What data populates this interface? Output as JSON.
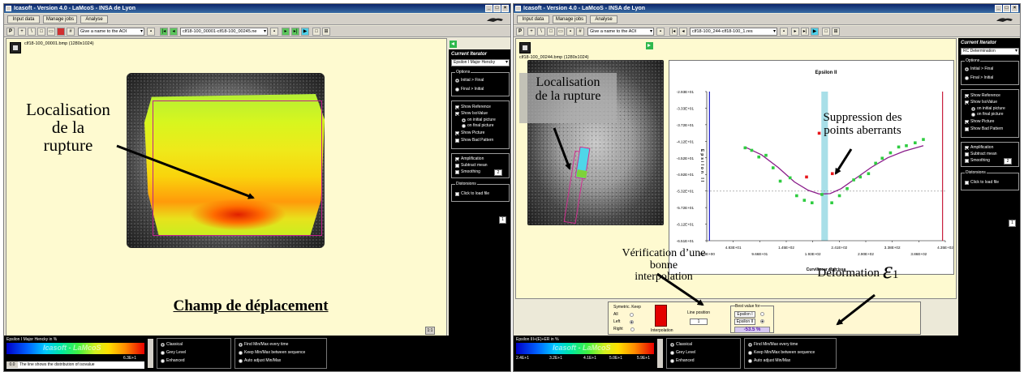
{
  "left_window": {
    "title": "Icasoft - Version 4.0 - LaMcoS - INSA de Lyon",
    "tabs": [
      "Input data",
      "Manage jobs",
      "Analyse"
    ],
    "aoi_combo": "Give a name to the AOI",
    "sequence_combo": "clf18-100_00001-clf18-100_00245.ne",
    "image_info": "clf18-100_00001.bmp (1280x1024)",
    "side_panel": {
      "title": "Current Iterator",
      "combo": "Epsilon I Major Hencky",
      "options_caption": "Options",
      "radio_initial_final": "Initial > Final",
      "radio_final_initial": "Final > Initial",
      "show_reference": "Show Reference",
      "show_isovalue": "Show IsoValue",
      "on_initial_picture": "on initial picture",
      "on_final_picture": "on final picture",
      "show_picture": "Show Picture",
      "show_bad_pattern": "Show Bad Pattern",
      "amplification": "Amplification",
      "subtract_mean": "Subtract mean",
      "smoothing": "Smoothing",
      "smoothing_value": "2",
      "distorsions_caption": "Distorsions",
      "click_to_load": "Click to load file",
      "page_button": "1"
    },
    "scale_button": "1:1",
    "colorbar": {
      "title": "Epsilon I Major Hencky in %",
      "logo": "Icasoft - LaMcoS",
      "tick_min": "0.0E+0",
      "tick_max": "6.3E+1",
      "status_value": "0.0",
      "status_text": "The line shows the distribution of isovalue"
    },
    "display_modes": [
      "Classical",
      "Grey Level",
      "Enhanced"
    ],
    "minmax_modes": [
      "Find Min/Max every time",
      "Keep Min/Max between sequence",
      "Auto adjust Min/Max"
    ]
  },
  "right_window": {
    "title": "Icasoft - Version 4.0 - LaMcoS - INSA de Lyon",
    "tabs": [
      "Input data",
      "Manage jobs",
      "Analyse"
    ],
    "aoi_combo": "Give a name to the AOI",
    "sequence_combo": "clf18-100_244-clf18-100_1.res",
    "image_info": "clf18-100_00244.bmp (1280x1024)",
    "side_panel": {
      "title": "Current Iterator",
      "combo": "RC Determination",
      "options_caption": "Options",
      "radio_initial_final": "Initial > Final",
      "radio_final_initial": "Final > Initial",
      "show_reference": "Show Reference",
      "show_isovalue": "Show IsoValue",
      "on_initial_picture": "on initial picture",
      "on_final_picture": "on final picture",
      "show_picture": "Show Picture",
      "show_bad_pattern": "Show Bad Pattern",
      "amplification": "Amplification",
      "subtract_mean": "Subtract mean",
      "smoothing": "Smoothing",
      "smoothing_value": "2",
      "distorsions_caption": "Distorsions",
      "click_to_load": "Click to load file",
      "page_button": "1"
    },
    "colorbar": {
      "title": "Epsilon III+(E)+ER in %",
      "logo": "Icasoft - LaMcoS",
      "ticks": [
        "2.4E+1",
        "3.2E+1",
        "4.1E+1",
        "5.0E+1",
        "5.9E+1"
      ]
    },
    "display_modes": [
      "Classical",
      "Grey Level",
      "Enhanced"
    ],
    "minmax_modes": [
      "Find Min/Max every time",
      "Keep Min/Max between sequence",
      "Auto adjust Min/Max"
    ],
    "control_panel": {
      "symetric_label": "Symetric. Keep",
      "opt_all": "All",
      "opt_left": "Left",
      "opt_right": "Right",
      "interpolation": "Interpolation",
      "line_position": "Line position",
      "line_position_value": "1",
      "best_value_for": "Best value for",
      "epsilon_1": "Epsilon I",
      "epsilon_2": "Epsilon II",
      "percent_value": "-53.5 %"
    }
  },
  "annotations": {
    "left_rupture": "Localisation\nde la\nrupture",
    "champ": "Champ de déplacement",
    "right_rupture": "Localisation\nde la rupture",
    "suppression": "Suppression des\npoints aberrants",
    "verification": "Vérification d’une\nbonne\ninterpolation",
    "deformation": "Déformation",
    "epsilon_symbol": "ε",
    "epsilon_sub": "1"
  },
  "chart_data": {
    "type": "scatter",
    "title": "Epsilon II",
    "xlabel": "Curvilinear abscissa",
    "ylabel": "Epsilon II",
    "x_ticks": [
      "0.00E+00",
      "4.83E+01",
      "9.66E+01",
      "1.45E+02",
      "1.93E+02",
      "2.41E+02",
      "2.90E+02",
      "3.38E+02",
      "3.86E+02",
      "4.35E+02"
    ],
    "y_ticks": [
      "-2.93E+01",
      "-3.33E+01",
      "-3.72E+01",
      "-4.12E+01",
      "-4.52E+01",
      "-4.92E+01",
      "-5.32E+01",
      "-5.72E+01",
      "-6.12E+01",
      "-6.51E+01"
    ],
    "xlim": [
      0,
      435
    ],
    "ylim": [
      -65.1,
      -29.3
    ],
    "grid": false,
    "legend": "none",
    "reference_line_y": -53.2,
    "rupture_band_x": [
      209,
      221
    ],
    "left_marker_x": 5,
    "right_marker_x": 430,
    "points_valid": [
      [
        70,
        -42.8
      ],
      [
        82,
        -43.4
      ],
      [
        95,
        -45.0
      ],
      [
        108,
        -44.6
      ],
      [
        121,
        -47.6
      ],
      [
        134,
        -50.8
      ],
      [
        152,
        -50.0
      ],
      [
        164,
        -54.3
      ],
      [
        178,
        -55.4
      ],
      [
        192,
        -56.0
      ],
      [
        210,
        -54.0
      ],
      [
        228,
        -56.0
      ],
      [
        242,
        -54.3
      ],
      [
        256,
        -52.6
      ],
      [
        268,
        -50.5
      ],
      [
        280,
        -49.8
      ],
      [
        295,
        -49.0
      ],
      [
        308,
        -46.5
      ],
      [
        320,
        -45.3
      ],
      [
        335,
        -44.0
      ],
      [
        350,
        -42.6
      ],
      [
        364,
        -42.3
      ],
      [
        380,
        -41.6
      ],
      [
        395,
        -40.8
      ]
    ],
    "points_rejected": [
      [
        182,
        -49.8
      ],
      [
        205,
        -39.3
      ],
      [
        229,
        -49.0
      ]
    ],
    "fit_curve": [
      [
        70,
        -42.6
      ],
      [
        100,
        -44.5
      ],
      [
        130,
        -47.5
      ],
      [
        160,
        -51.0
      ],
      [
        185,
        -53.0
      ],
      [
        205,
        -53.9
      ],
      [
        225,
        -53.8
      ],
      [
        245,
        -52.6
      ],
      [
        270,
        -50.3
      ],
      [
        300,
        -47.5
      ],
      [
        330,
        -45.2
      ],
      [
        360,
        -43.6
      ],
      [
        395,
        -42.3
      ]
    ]
  }
}
